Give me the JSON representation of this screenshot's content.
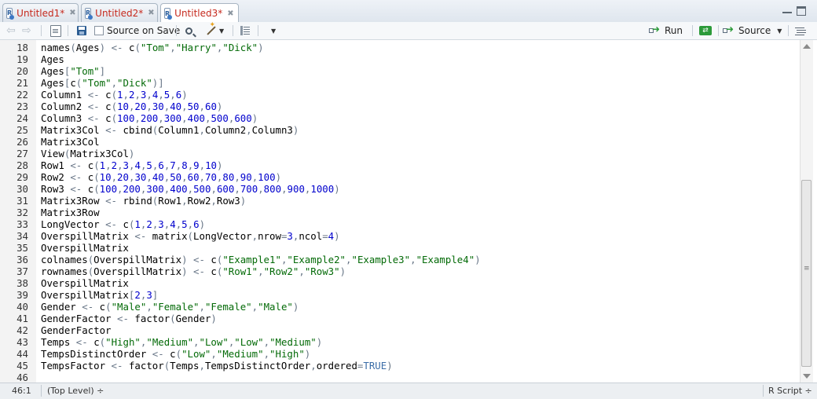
{
  "tabs": [
    {
      "label": "Untitled1*",
      "active": false
    },
    {
      "label": "Untitled2*",
      "active": false
    },
    {
      "label": "Untitled3*",
      "active": true
    }
  ],
  "toolbar": {
    "source_on_save_label": "Source on Save",
    "run_label": "Run",
    "source_label": "Source"
  },
  "editor": {
    "first_line": 18,
    "lines": [
      "names(Ages) <- c(\"Tom\",\"Harry\",\"Dick\")",
      "Ages",
      "Ages[\"Tom\"]",
      "Ages[c(\"Tom\",\"Dick\")]",
      "Column1 <- c(1,2,3,4,5,6)",
      "Column2 <- c(10,20,30,40,50,60)",
      "Column3 <- c(100,200,300,400,500,600)",
      "Matrix3Col <- cbind(Column1,Column2,Column3)",
      "Matrix3Col",
      "View(Matrix3Col)",
      "Row1 <- c(1,2,3,4,5,6,7,8,9,10)",
      "Row2 <- c(10,20,30,40,50,60,70,80,90,100)",
      "Row3 <- c(100,200,300,400,500,600,700,800,900,1000)",
      "Matrix3Row <- rbind(Row1,Row2,Row3)",
      "Matrix3Row",
      "LongVector <- c(1,2,3,4,5,6)",
      "OverspillMatrix <- matrix(LongVector,nrow=3,ncol=4)",
      "OverspillMatrix",
      "colnames(OverspillMatrix) <- c(\"Example1\",\"Example2\",\"Example3\",\"Example4\")",
      "rownames(OverspillMatrix) <- c(\"Row1\",\"Row2\",\"Row3\")",
      "OverspillMatrix",
      "OverspillMatrix[2,3]",
      "Gender <- c(\"Male\",\"Female\",\"Female\",\"Male\")",
      "GenderFactor <- factor(Gender)",
      "GenderFactor",
      "Temps <- c(\"High\",\"Medium\",\"Low\",\"Low\",\"Medium\")",
      "TempsDistinctOrder <- c(\"Low\",\"Medium\",\"High\")",
      "TempsFactor <- factor(Temps,TempsDistinctOrder,ordered=TRUE)",
      ""
    ]
  },
  "status": {
    "cursor_position": "46:1",
    "scope": "(Top Level) ÷",
    "file_type": "R Script ÷"
  },
  "colors": {
    "tab_title": "#c62a1e",
    "number": "#0000cd",
    "string": "#036a07",
    "operator": "#687687",
    "keyword": "#3c6ea8"
  }
}
